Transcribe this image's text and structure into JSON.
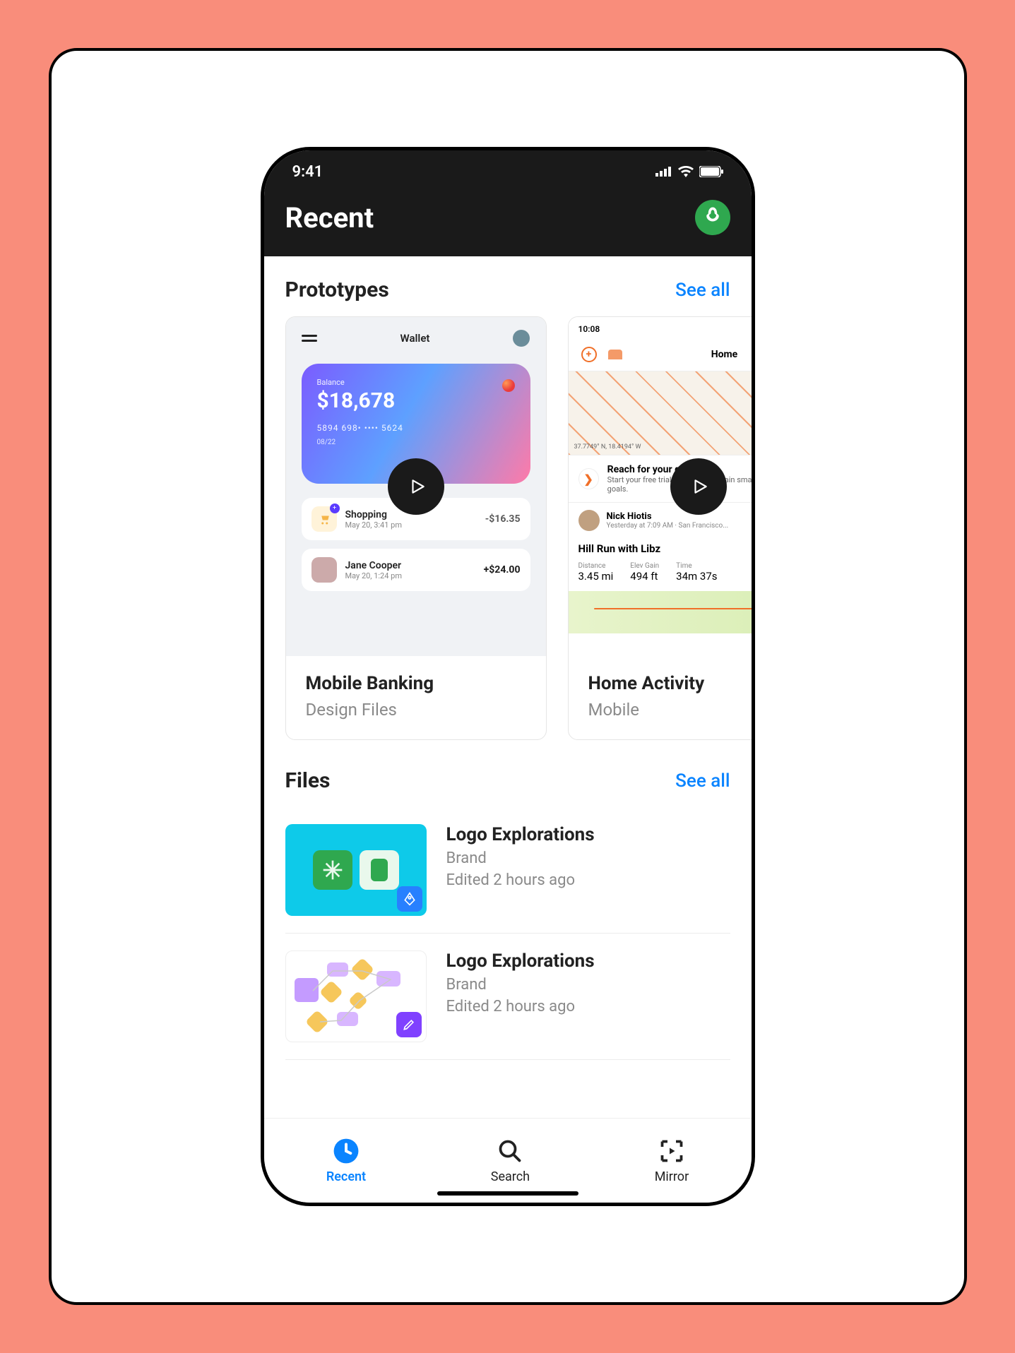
{
  "status": {
    "time": "9:41"
  },
  "header": {
    "title": "Recent"
  },
  "sections": {
    "prototypes": {
      "title": "Prototypes",
      "see_all": "See all"
    },
    "files": {
      "title": "Files",
      "see_all": "See all"
    }
  },
  "prototypes": [
    {
      "name": "Mobile Banking",
      "subtitle": "Design Files",
      "wallet": {
        "title": "Wallet",
        "balance_label": "Balance",
        "balance": "$18,678",
        "digits": "5894   698•   ••••   5624",
        "expiry": "08/22",
        "tx": [
          {
            "name": "Shopping",
            "time": "May 20, 3:41 pm",
            "amount": "-$16.35"
          },
          {
            "name": "Jane Cooper",
            "time": "May 20, 1:24 pm",
            "amount": "+$24.00"
          }
        ]
      }
    },
    {
      "name": "Home Activity",
      "subtitle": "Mobile",
      "activity": {
        "time": "10:08",
        "home": "Home",
        "coords": "37.7749° N, 18.4194° W",
        "reach_title": "Reach for your goals",
        "reach_desc": "Start your free trial, get the data, train smart and get your goals.",
        "user_name": "Nick Hiotis",
        "user_meta": "Yesterday at 7:09 AM · San Francisco...",
        "run_title": "Hill Run with Libz",
        "stats": {
          "distance_label": "Distance",
          "distance": "3.45 mi",
          "elev_label": "Elev Gain",
          "elev": "494 ft",
          "time_label": "Time",
          "time_val": "34m 37s"
        }
      }
    }
  ],
  "files": [
    {
      "name": "Logo Explorations",
      "subtitle": "Brand",
      "edited": "Edited 2 hours ago",
      "kind": "design"
    },
    {
      "name": "Logo Explorations",
      "subtitle": "Brand",
      "edited": "Edited 2 hours ago",
      "kind": "figjam"
    }
  ],
  "tabs": {
    "recent": "Recent",
    "search": "Search",
    "mirror": "Mirror"
  }
}
